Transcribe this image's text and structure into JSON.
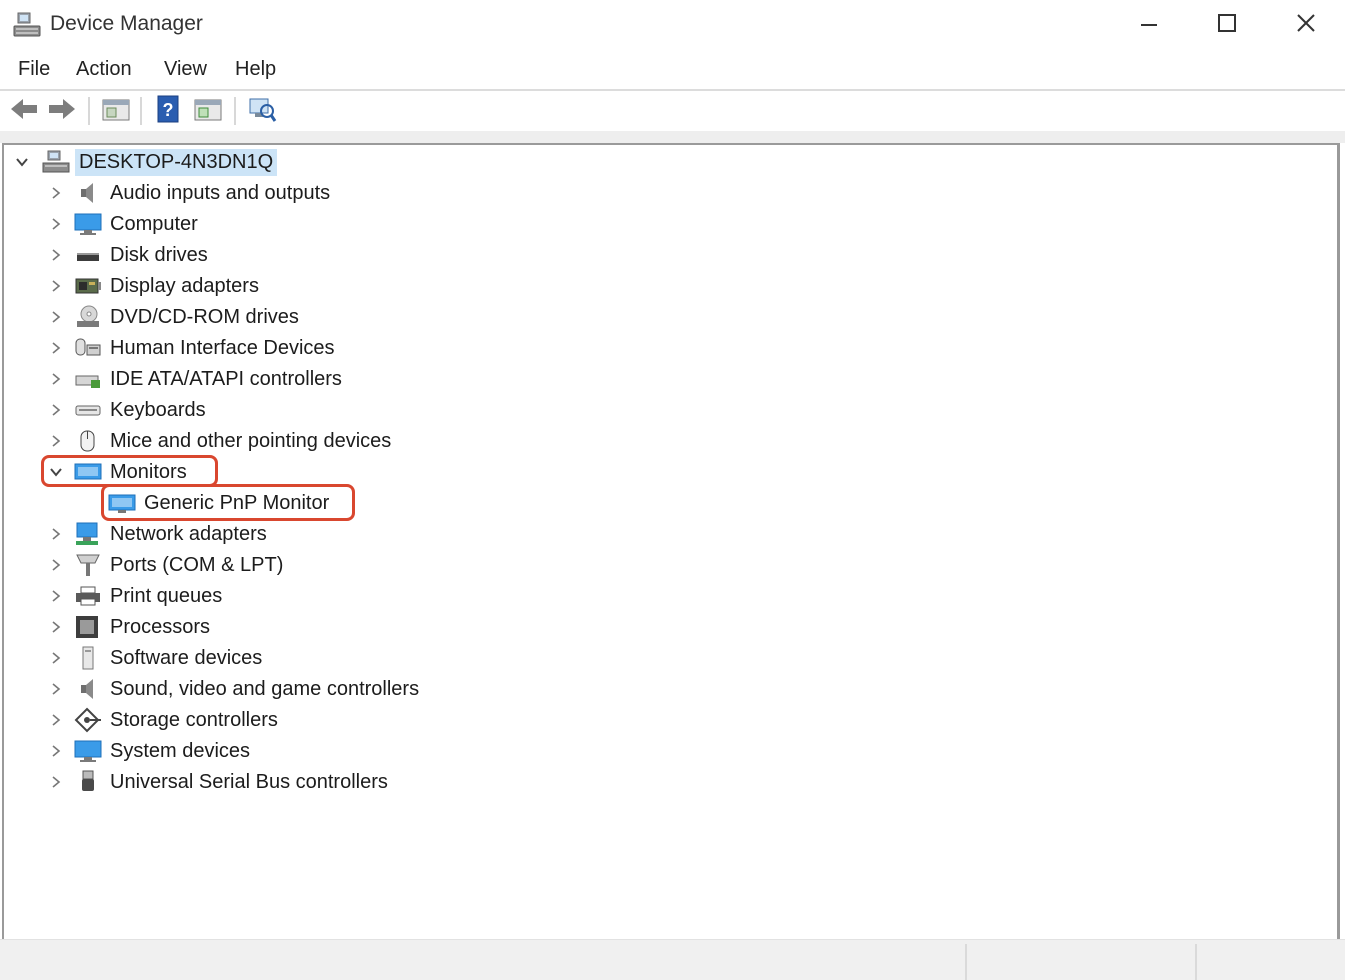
{
  "window": {
    "title": "Device Manager",
    "controls": {
      "minimize": "minimize-icon",
      "maximize": "maximize-icon",
      "close": "close-icon"
    }
  },
  "menu": [
    "File",
    "Action",
    "View",
    "Help"
  ],
  "toolbar": [
    "back-icon",
    "forward-icon",
    "properties-icon",
    "help-icon",
    "update-driver-icon",
    "scan-hardware-icon"
  ],
  "tree": {
    "root": {
      "label": "DESKTOP-4N3DN1Q",
      "expanded": true,
      "icon": "computer-network-icon"
    },
    "categories": [
      {
        "label": "Audio inputs and outputs",
        "icon": "speaker-icon",
        "expanded": false
      },
      {
        "label": "Computer",
        "icon": "monitor-icon",
        "expanded": false
      },
      {
        "label": "Disk drives",
        "icon": "disk-drive-icon",
        "expanded": false
      },
      {
        "label": "Display adapters",
        "icon": "display-adapter-icon",
        "expanded": false
      },
      {
        "label": "DVD/CD-ROM drives",
        "icon": "dvd-drive-icon",
        "expanded": false
      },
      {
        "label": "Human Interface Devices",
        "icon": "hid-icon",
        "expanded": false
      },
      {
        "label": "IDE ATA/ATAPI controllers",
        "icon": "ide-controller-icon",
        "expanded": false
      },
      {
        "label": "Keyboards",
        "icon": "keyboard-icon",
        "expanded": false
      },
      {
        "label": "Mice and other pointing devices",
        "icon": "mouse-icon",
        "expanded": false
      },
      {
        "label": "Monitors",
        "icon": "monitor-icon",
        "expanded": true,
        "highlighted": true,
        "children": [
          {
            "label": "Generic PnP Monitor",
            "icon": "monitor-icon",
            "highlighted": true
          }
        ]
      },
      {
        "label": "Network adapters",
        "icon": "network-adapter-icon",
        "expanded": false
      },
      {
        "label": "Ports (COM & LPT)",
        "icon": "port-icon",
        "expanded": false
      },
      {
        "label": "Print queues",
        "icon": "printer-icon",
        "expanded": false
      },
      {
        "label": "Processors",
        "icon": "processor-icon",
        "expanded": false
      },
      {
        "label": "Software devices",
        "icon": "software-device-icon",
        "expanded": false
      },
      {
        "label": "Sound, video and game controllers",
        "icon": "speaker-icon",
        "expanded": false
      },
      {
        "label": "Storage controllers",
        "icon": "storage-controller-icon",
        "expanded": false
      },
      {
        "label": "System devices",
        "icon": "system-device-icon",
        "expanded": false
      },
      {
        "label": "Universal Serial Bus controllers",
        "icon": "usb-icon",
        "expanded": false
      }
    ]
  },
  "colors": {
    "highlight": "#d9472f",
    "selection": "#cce4f7",
    "accent": "#1e7fd8"
  }
}
